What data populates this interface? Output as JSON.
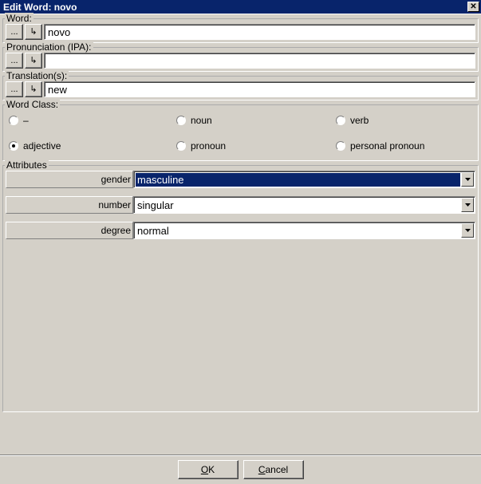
{
  "title": "Edit Word: novo",
  "fields": {
    "word_label": "Word:",
    "word_value": "novo",
    "pronunciation_label": "Pronunciation (IPA):",
    "pronunciation_value": "",
    "translations_label": "Translation(s):",
    "translations_value": "new",
    "ellipsis_btn": "...",
    "arrow_btn": "↳"
  },
  "word_class": {
    "label": "Word Class:",
    "options": [
      {
        "label": "–",
        "checked": false
      },
      {
        "label": "noun",
        "checked": false
      },
      {
        "label": "verb",
        "checked": false
      },
      {
        "label": "adjective",
        "checked": true
      },
      {
        "label": "pronoun",
        "checked": false
      },
      {
        "label": "personal pronoun",
        "checked": false
      }
    ]
  },
  "attributes": {
    "label": "Attributes",
    "rows": [
      {
        "name": "gender",
        "value": "masculine",
        "highlight": true
      },
      {
        "name": "number",
        "value": "singular",
        "highlight": false
      },
      {
        "name": "degree",
        "value": "normal",
        "highlight": false
      }
    ]
  },
  "buttons": {
    "ok": "OK",
    "cancel": "Cancel"
  }
}
